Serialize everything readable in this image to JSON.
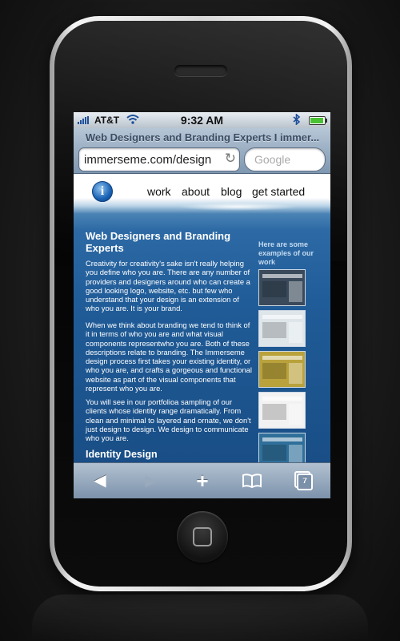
{
  "status_bar": {
    "carrier": "AT&T",
    "time": "9:32 AM"
  },
  "browser": {
    "page_title": "Web Designers and Branding Experts I immer...",
    "url": "immerseme.com/design",
    "search_placeholder": "Google",
    "tab_count": "7"
  },
  "site": {
    "logo_letter": "i",
    "nav": [
      "work",
      "about",
      "blog",
      "get started"
    ],
    "heading": "Web Designers and Branding Experts",
    "paragraphs": [
      "Creativity for creativity's sake isn't really helping you define who you are. There are any number of providers and designers around who can create a good looking logo, website, etc. but few who understand that your design is an extension of who you are. It is your brand.",
      "When we think about branding we tend to think of it in terms of who you are and what visual components representwho you are. Both of these descriptions relate to branding. The Immerseme design process first takes your existing identity, or who you are,  and crafts a gorgeous and functional website as part of the visual components that represent who you are.",
      "You will see in our portfolioa sampling of our clients whose identity range dramatically. From clean and minimal to layered and ornate, we don't just design to design. We design to communicate who you are."
    ],
    "section_heading": "Identity Design",
    "sidebar_label": "Here are some examples of our work",
    "thumbnail_colors": [
      "#3a4a5a",
      "#dfe6ea",
      "#b9a23c",
      "#f2f2f2",
      "#2f6f9a"
    ]
  },
  "toolbar": {
    "back": "◀",
    "forward": "▶",
    "add": "+"
  },
  "colors": {
    "page_blue": "#205c98",
    "toolbar": "#7b91aa"
  }
}
